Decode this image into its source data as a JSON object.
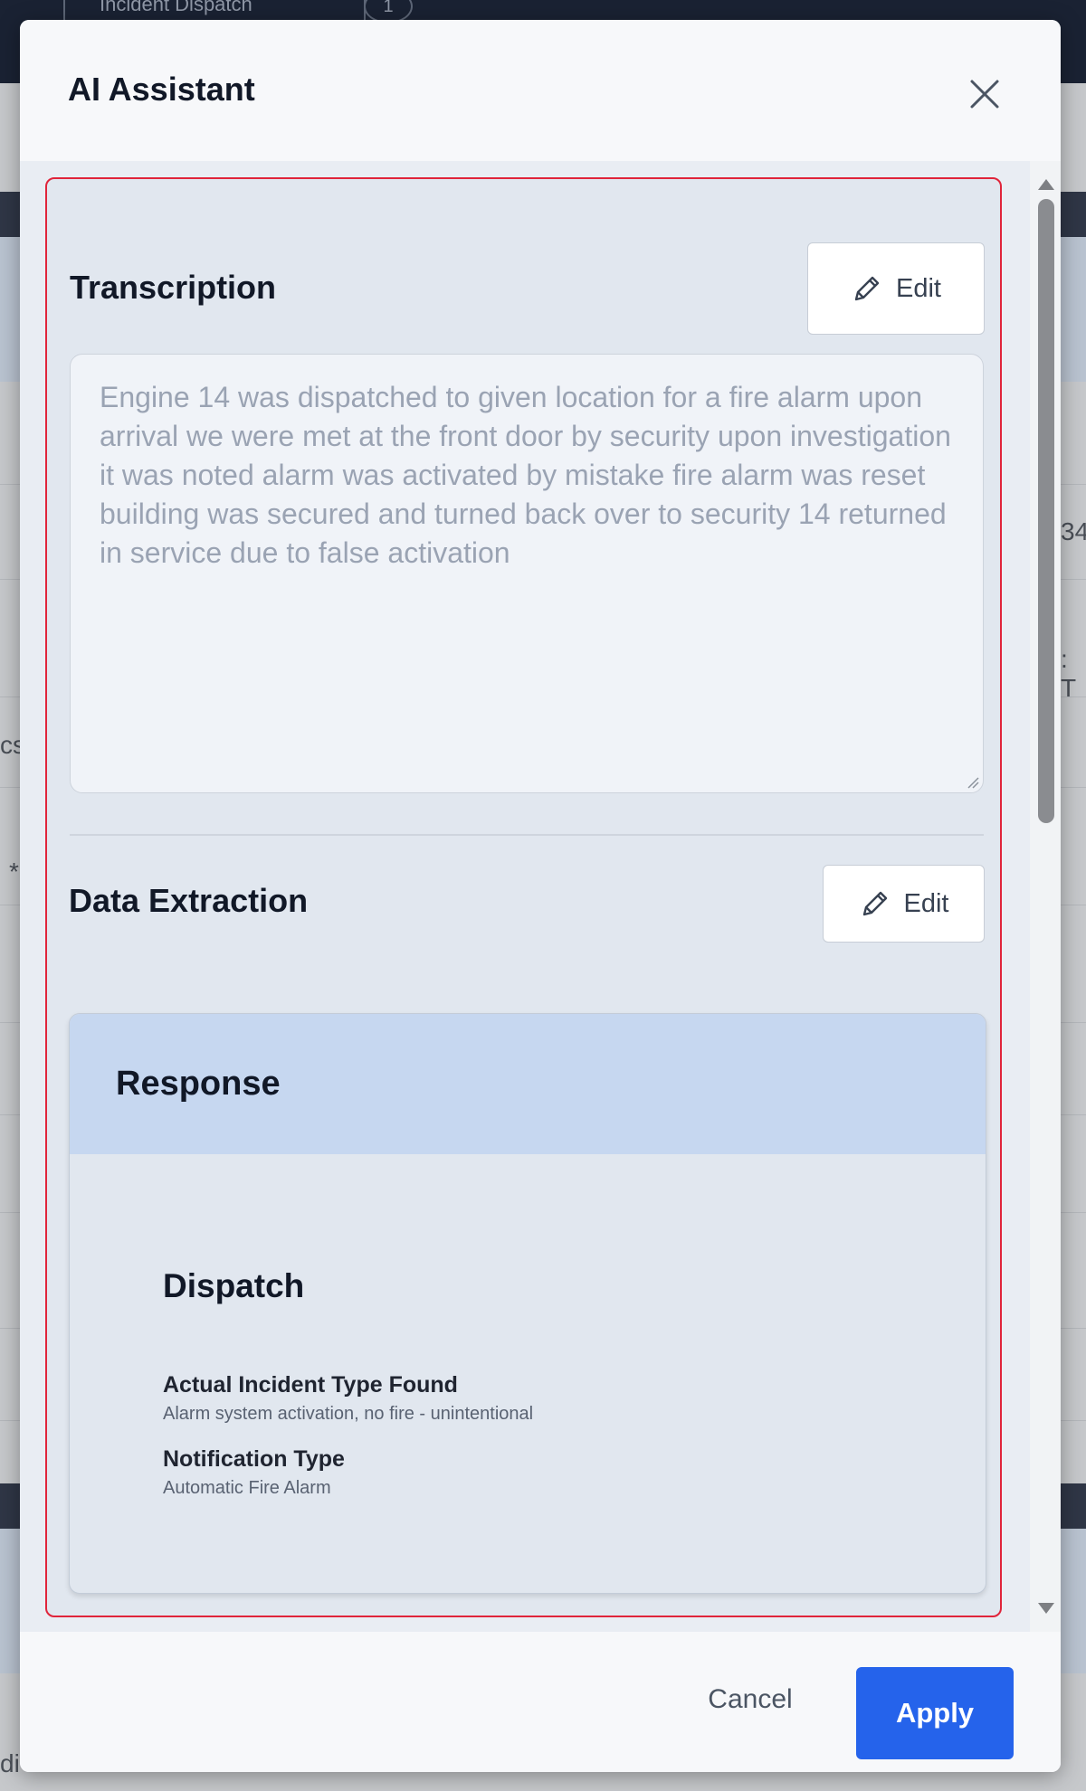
{
  "background": {
    "chip_label": "Incident Dispatch",
    "chip_badge": "1",
    "fragments": [
      "34",
      ": T",
      "cs",
      "*",
      "di"
    ]
  },
  "modal": {
    "title": "AI Assistant",
    "close_icon": "close-icon",
    "transcription": {
      "title": "Transcription",
      "edit_label": "Edit",
      "text": "Engine 14 was dispatched to given location for a fire alarm upon arrival we were met at the front door by security upon investigation it was noted alarm was activated by mistake fire alarm was reset building was secured and turned back over to security 14 returned in service due to false activation"
    },
    "data_extraction": {
      "title": "Data Extraction",
      "edit_label": "Edit"
    },
    "response": {
      "title": "Response",
      "dispatch_title": "Dispatch",
      "fields": [
        {
          "label": "Actual Incident Type Found",
          "value": "Alarm system activation, no fire - unintentional"
        },
        {
          "label": "Notification Type",
          "value": "Automatic Fire Alarm"
        }
      ]
    },
    "footer": {
      "cancel_label": "Cancel",
      "apply_label": "Apply"
    }
  },
  "colors": {
    "accent": "#2563eb",
    "highlight_border": "#e0243a",
    "response_header": "#c6d7f0"
  }
}
